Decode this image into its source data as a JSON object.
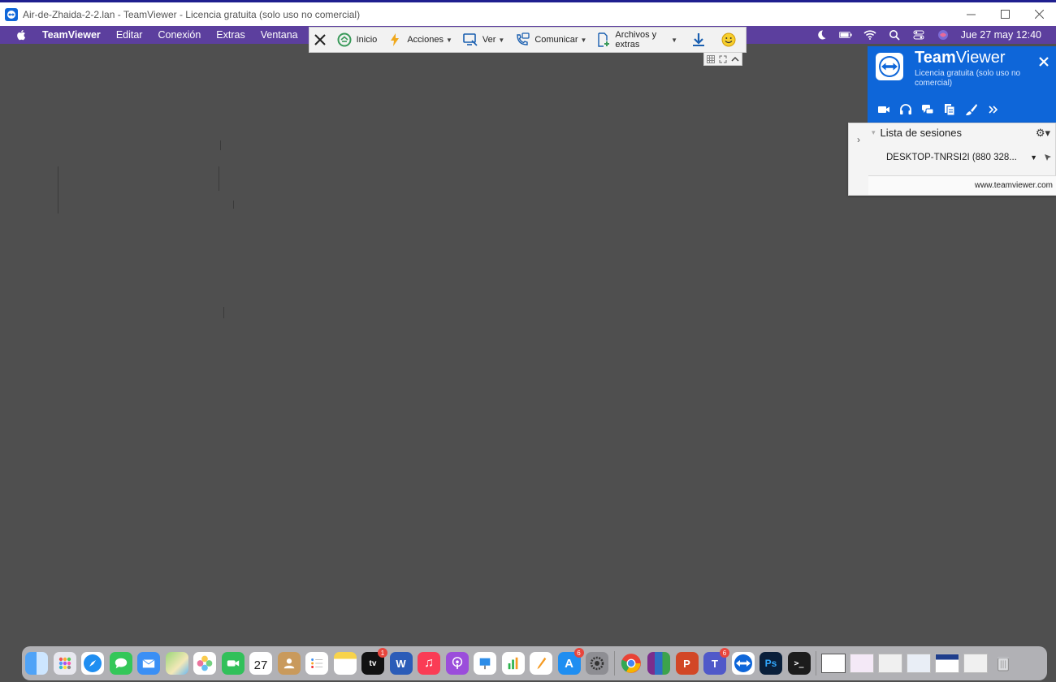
{
  "window": {
    "title": "Air-de-Zhaida-2-2.lan - TeamViewer - Licencia gratuita (solo uso no comercial)"
  },
  "menubar": {
    "app_name": "TeamViewer",
    "items": [
      "Editar",
      "Conexión",
      "Extras",
      "Ventana"
    ],
    "clock": "Jue 27 may  12:40"
  },
  "toolbar": {
    "inicio": "Inicio",
    "acciones": "Acciones",
    "ver": "Ver",
    "comunicar": "Comunicar",
    "archivos": "Archivos y extras"
  },
  "panel": {
    "brand_bold": "Team",
    "brand_rest": "Viewer",
    "license": "Licencia gratuita (solo uso no comercial)",
    "sessions_title": "Lista de sesiones",
    "session_name": "DESKTOP-TNRSI2I (880 328...",
    "url": "www.teamviewer.com"
  },
  "dock": {
    "calendar_day": "27",
    "tv_badge": "1",
    "appstore_badge": "6",
    "teams_badge": "6"
  },
  "colors": {
    "menubar": "#5c3f9e",
    "teamviewer_blue": "#0e66d9",
    "desktop": "#4f4f4f"
  }
}
